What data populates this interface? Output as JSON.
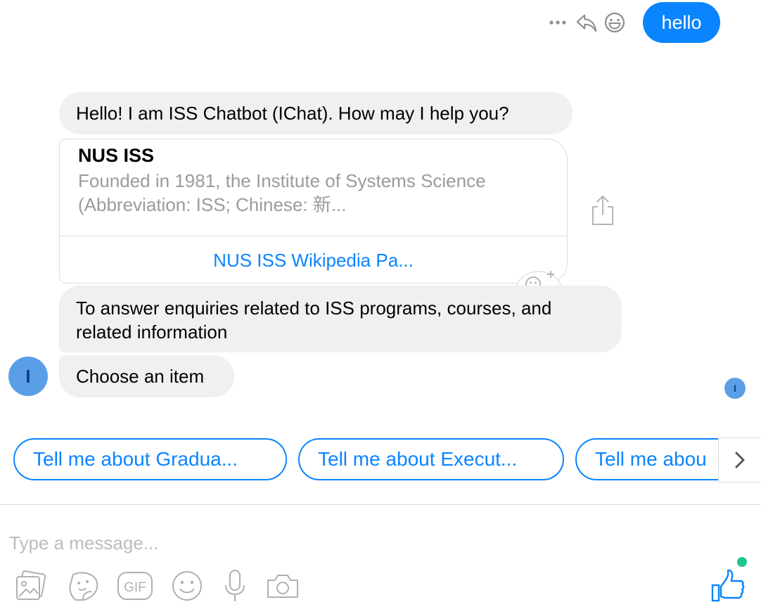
{
  "outgoing": {
    "text": "hello"
  },
  "message_actions": [
    {
      "name": "more-icon"
    },
    {
      "name": "reply-icon"
    },
    {
      "name": "react-icon"
    }
  ],
  "messages": {
    "greeting": "Hello! I am ISS Chatbot (IChat).  How may I help you?",
    "card": {
      "title": "NUS ISS",
      "description": "Founded in 1981, the Institute of Systems Science (Abbreviation: ISS; Chinese: 新...",
      "link_label": "NUS ISS Wikipedia Pa..."
    },
    "purpose": "To answer enquiries related to ISS programs, courses, and related information",
    "prompt": "Choose an item"
  },
  "bot": {
    "avatar_letter": "I",
    "seen_letter": "I"
  },
  "quick_replies": [
    "Tell me about Gradua...",
    "Tell me about Execut...",
    "Tell me abou"
  ],
  "composer": {
    "placeholder": "Type a message...",
    "tools": [
      "image-icon",
      "sticker-icon",
      "gif-icon",
      "emoji-icon",
      "microphone-icon",
      "camera-icon"
    ],
    "gif_label": "GIF"
  },
  "colors": {
    "accent": "#0a84ff",
    "bubble_grey": "#f0f0f0",
    "online": "#22c58b",
    "avatar": "#5b9ee8"
  }
}
